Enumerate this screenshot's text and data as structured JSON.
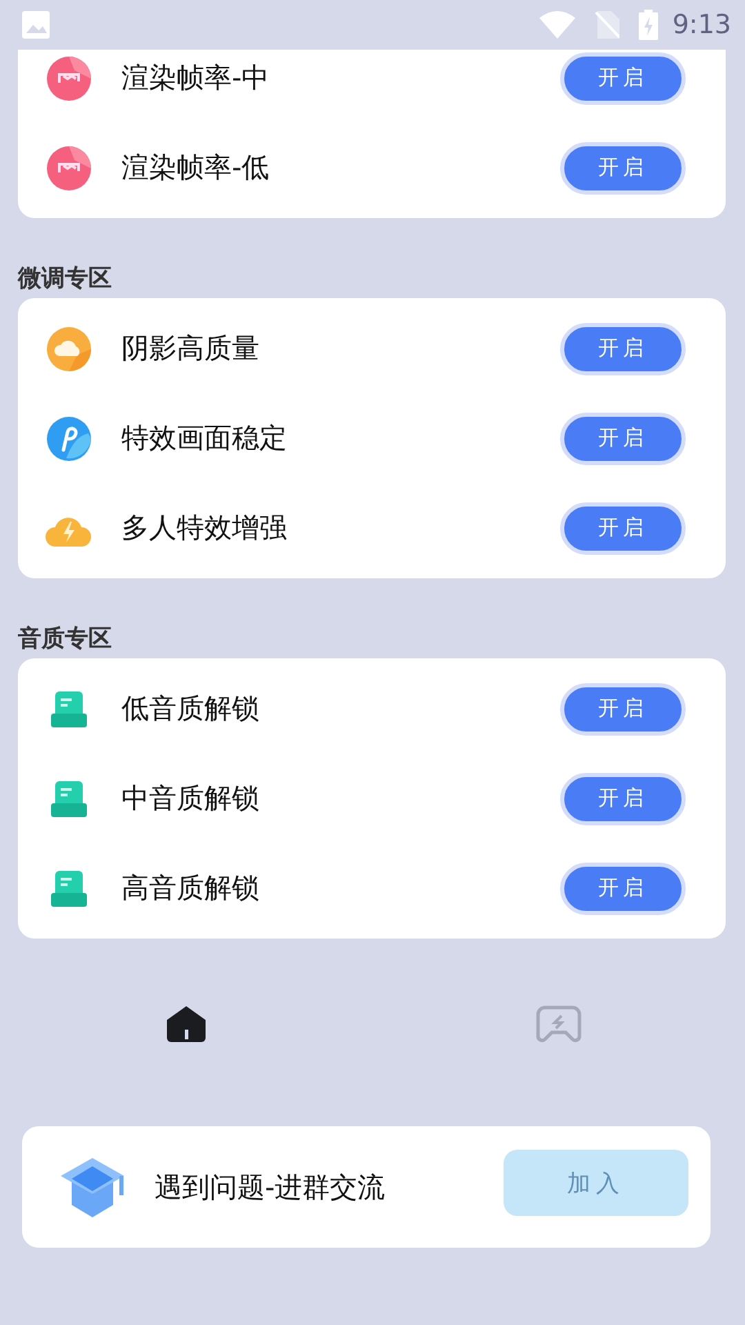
{
  "status_bar": {
    "time": "9:13"
  },
  "sections": [
    {
      "rows": [
        {
          "kind": "film",
          "label": "渲染帧率-中",
          "button": "开启"
        },
        {
          "kind": "film",
          "label": "渲染帧率-低",
          "button": "开启"
        }
      ]
    },
    {
      "title": "微调专区",
      "rows": [
        {
          "kind": "cloud",
          "label": "阴影高质量",
          "button": "开启"
        },
        {
          "kind": "brush",
          "label": "特效画面稳定",
          "button": "开启"
        },
        {
          "kind": "storm",
          "label": "多人特效增强",
          "button": "开启"
        }
      ]
    },
    {
      "title": "音质专区",
      "rows": [
        {
          "kind": "box",
          "label": "低音质解锁",
          "button": "开启"
        },
        {
          "kind": "box",
          "label": "中音质解锁",
          "button": "开启"
        },
        {
          "kind": "box",
          "label": "高音质解锁",
          "button": "开启"
        }
      ]
    }
  ],
  "nav": [
    {
      "kind": "home",
      "selected": true
    },
    {
      "kind": "gamepad",
      "selected": false
    }
  ],
  "join_card": {
    "text": "遇到问题-进群交流",
    "button": "加入",
    "disabled": true
  }
}
